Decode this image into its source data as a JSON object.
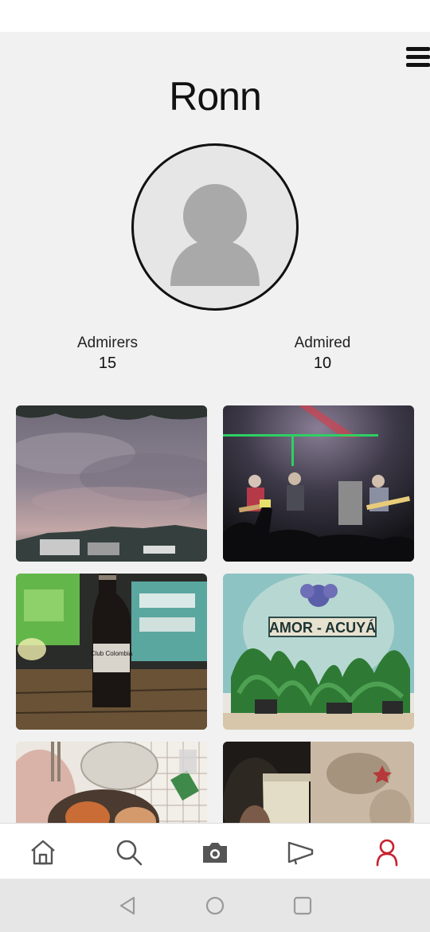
{
  "profile": {
    "username": "Ronn",
    "stats": {
      "admirers_label": "Admirers",
      "admirers_count": "15",
      "admired_label": "Admired",
      "admired_count": "10"
    }
  },
  "photo_signs": {
    "beer_label": "Club Colombia",
    "mural_text": "AMOR - ACUYÁ"
  },
  "bottom_nav": {
    "items": [
      "home-icon",
      "search-icon",
      "camera-icon",
      "megaphone-icon",
      "profile-icon"
    ],
    "active": "profile-icon",
    "active_color": "#c8202e",
    "inactive_color": "#555555"
  },
  "system_nav": [
    "back-icon",
    "home-circle-icon",
    "recents-icon"
  ]
}
